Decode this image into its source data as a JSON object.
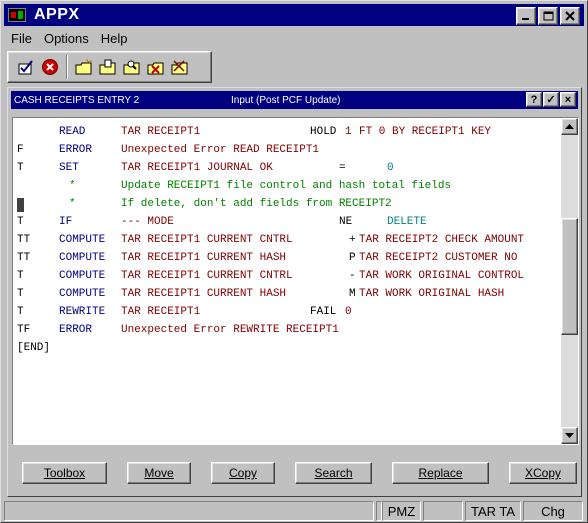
{
  "app": {
    "title": "APPX"
  },
  "menu": [
    "File",
    "Options",
    "Help"
  ],
  "toolbar": {
    "tools": [
      "check-icon",
      "cancel-icon",
      "folder-new-icon",
      "folder-edit-icon",
      "folder-search-icon",
      "folder-delete-icon",
      "folder-check-icon"
    ]
  },
  "inner": {
    "left_title": "CASH RECEIPTS ENTRY 2",
    "mid_title": "Input  (Post PCF Update)",
    "btn_help": "?",
    "btn_ok": "✓",
    "btn_close": "×"
  },
  "code": {
    "lines": [
      {
        "flag": "",
        "op": "READ",
        "a": "TAR RECEIPT1",
        "b": "HOLD",
        "c": "1",
        "d": "FT 0 BY RECEIPT1 KEY"
      },
      {
        "flag": "F",
        "op": "ERROR",
        "a": "Unexpected Error READ RECEIPT1",
        "b": "",
        "c": "",
        "d": ""
      },
      {
        "flag": "T",
        "op": "SET",
        "a": "TAR RECEIPT1 JOURNAL OK",
        "b": "=",
        "c": "0",
        "d": ""
      },
      {
        "flag": "",
        "op": "*",
        "comment": "Update RECEIPT1 file control and hash total fields"
      },
      {
        "flag": "",
        "op": "*",
        "comment": "If delete, don't add fields from RECEIPT2"
      },
      {
        "flag": "T",
        "op": "IF",
        "a": "--- MODE",
        "b": "NE",
        "c": "DELETE",
        "d": ""
      },
      {
        "flag": "TT",
        "op": "COMPUTE",
        "a": "TAR RECEIPT1 CURRENT CNTRL",
        "b": "+",
        "c": "TAR RECEIPT2 CHECK AMOUNT",
        "d": ""
      },
      {
        "flag": "TT",
        "op": "COMPUTE",
        "a": "TAR RECEIPT1 CURRENT HASH",
        "b": "P",
        "c": "TAR RECEIPT2 CUSTOMER NO",
        "d": ""
      },
      {
        "flag": "T",
        "op": "COMPUTE",
        "a": "TAR RECEIPT1 CURRENT CNTRL",
        "b": "-",
        "c": "TAR WORK ORIGINAL CONTROL",
        "d": ""
      },
      {
        "flag": "T",
        "op": "COMPUTE",
        "a": "TAR RECEIPT1 CURRENT HASH",
        "b": "M",
        "c": "TAR WORK ORIGINAL HASH",
        "d": ""
      },
      {
        "flag": "T",
        "op": "REWRITE",
        "a": "TAR RECEIPT1",
        "b": "FAIL",
        "c": "0",
        "d": ""
      },
      {
        "flag": "TF",
        "op": "ERROR",
        "a": "Unexpected Error REWRITE RECEIPT1",
        "b": "",
        "c": "",
        "d": ""
      },
      {
        "flag": "[END]",
        "op": "",
        "a": "",
        "b": "",
        "c": "",
        "d": ""
      }
    ]
  },
  "buttons": {
    "toolbox": "Toolbox",
    "move": "Move",
    "copy": "Copy",
    "search": "Search",
    "replace": "Replace",
    "xcopy": "XCopy"
  },
  "status": {
    "cell1": "",
    "cell2": "",
    "cell3": "PMZ",
    "cell4": "",
    "cell5": "TAR TA",
    "cell6": "Chg"
  },
  "colors": {
    "titlebar": "#000080",
    "keyword": "#000080",
    "field": "#800000",
    "comment": "#008000",
    "literal": "#008080"
  }
}
